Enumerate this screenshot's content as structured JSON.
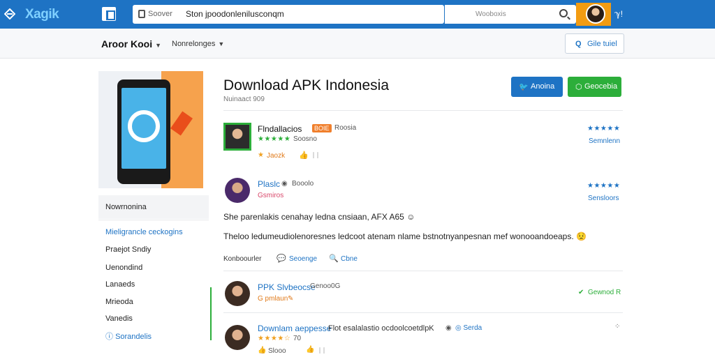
{
  "header": {
    "logo": "Xagik",
    "search_label": "Soover",
    "search_value": "Ston jpoodonlenilusconqm",
    "search2_placeholder": "Wooboxis"
  },
  "subnav": {
    "primary": "Aroor Kooi",
    "secondary": "Nonrelonges",
    "button_label": "Gile tuiel"
  },
  "sidebar": {
    "title": "Nowrnonina",
    "items": [
      "Mieligrancle ceckogins",
      "Praejot Sndiy",
      "Uenondind",
      "Lanaeds",
      "Mrieoda",
      "Vanedis",
      "Sorandelis"
    ]
  },
  "main": {
    "title": "Download APK Indonesia",
    "subtitle": "Nuinaact 909",
    "btn_primary": "Anoina",
    "btn_secondary": "Geocebia"
  },
  "posts": [
    {
      "name": "Flndallacios",
      "badge": "BOIE",
      "tag": "Roosia",
      "sub": "Soosno",
      "meta1": "Jaozk",
      "meta2": "ᛁᛁ",
      "rating_label": "Semnlenn"
    },
    {
      "name": "Plaslc",
      "tag": "Booolo",
      "sub": "Gsmiros",
      "rating_label": "Sensloors",
      "line1": "She parenlakis cenahay ledna cnsiaan, AFX A65",
      "line2": "Theloo ledumeudiolenoresnes ledcoot atenam nlame bstnotnyanpesnan mef wonooandoeaps.",
      "author": "Konboourler",
      "action1": "Seoenge",
      "action2": "Cbne"
    },
    {
      "name": "PPK Slvbeocse",
      "tag": "Genoo0G",
      "sub": "G pmlaun",
      "rating_label": "Gewnod R"
    },
    {
      "name": "Downlam aeppesse",
      "text": "Flot esalalastio ocdoolcoetdlpK",
      "tag": "Serda",
      "meta1": "Slooo",
      "meta2": "70"
    }
  ],
  "colors": {
    "brand_blue": "#1e73c4",
    "accent_green": "#2cae3a",
    "accent_orange": "#f39c12"
  }
}
